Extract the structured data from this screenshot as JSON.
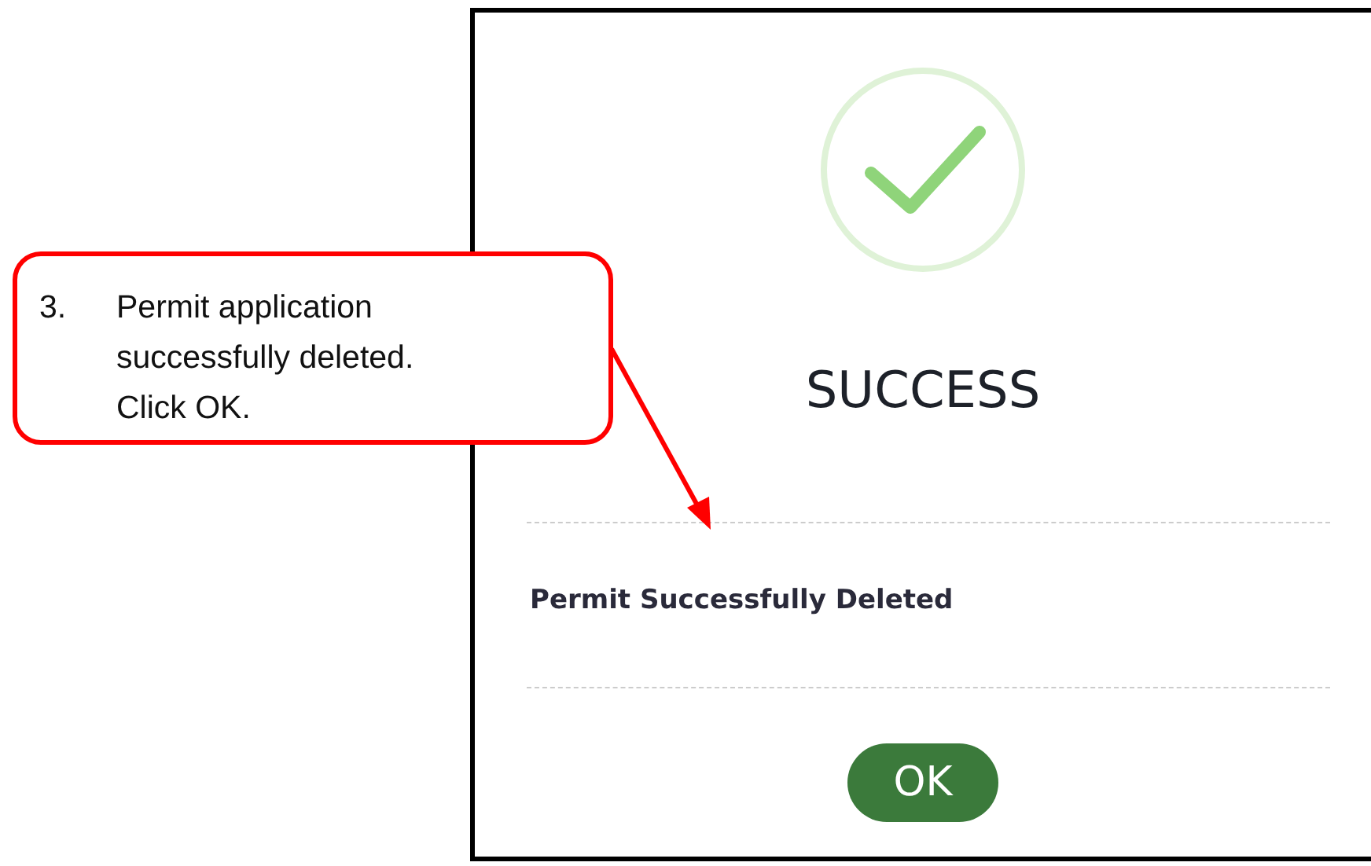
{
  "dialog": {
    "title": "SUCCESS",
    "message": "Permit Successfully Deleted",
    "button": "OK"
  },
  "callout": {
    "number": "3.",
    "text": "Permit application successfully deleted. Click OK."
  }
}
